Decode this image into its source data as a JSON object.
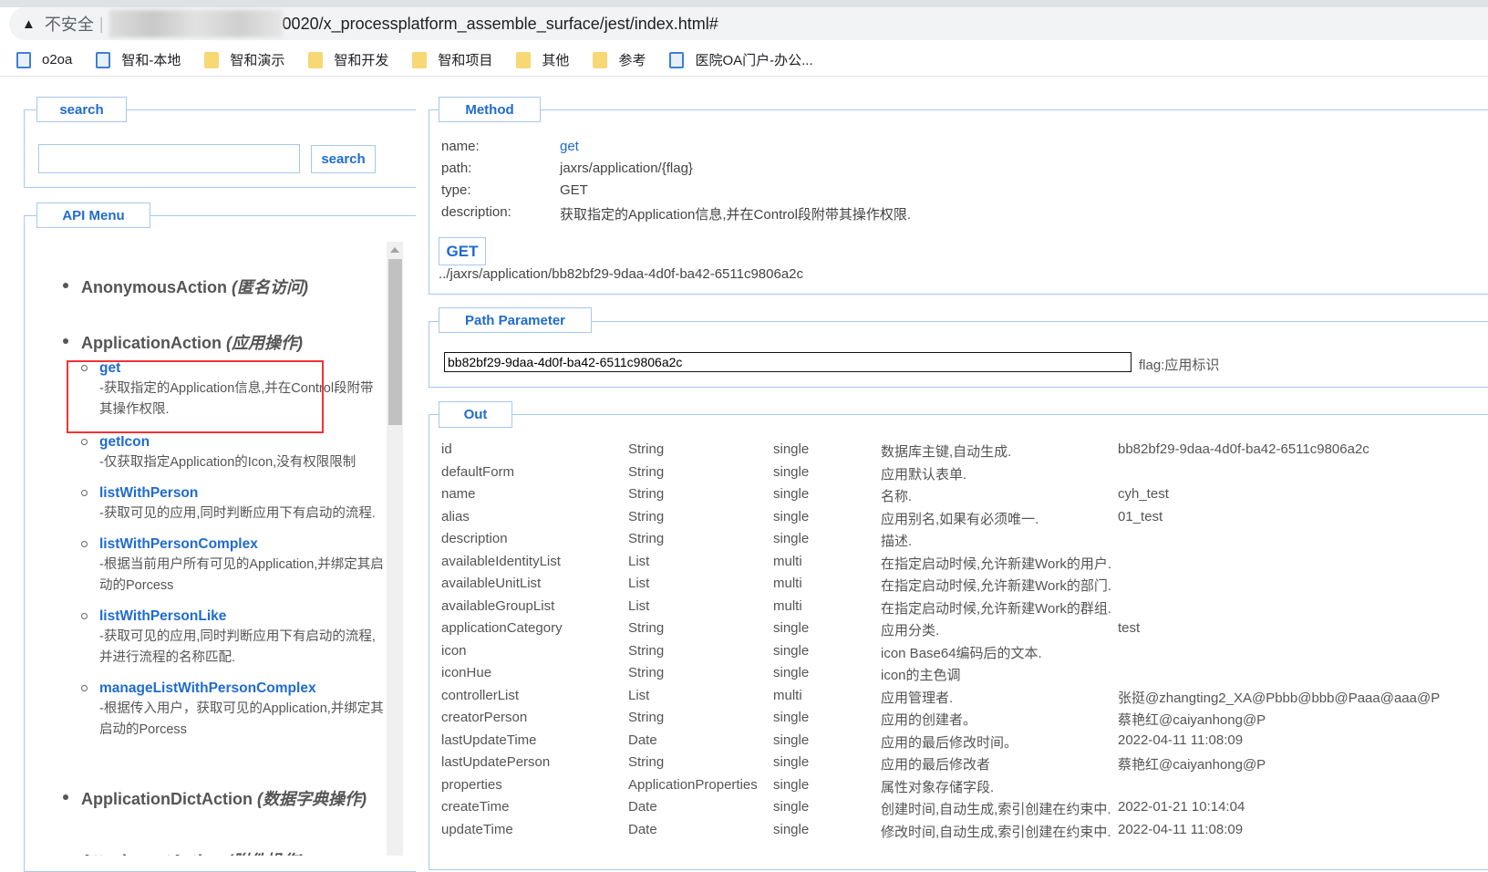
{
  "browser": {
    "insecure_label": "不安全",
    "url": "0020/x_processplatform_assemble_surface/jest/index.html#"
  },
  "bookmarks": [
    {
      "label": "o2oa",
      "icon": "page-icon"
    },
    {
      "label": "智和-本地",
      "icon": "page-icon"
    },
    {
      "label": "智和演示",
      "icon": "folder-icon"
    },
    {
      "label": "智和开发",
      "icon": "folder-icon"
    },
    {
      "label": "智和项目",
      "icon": "folder-icon"
    },
    {
      "label": "其他",
      "icon": "folder-icon"
    },
    {
      "label": "参考",
      "icon": "folder-icon"
    },
    {
      "label": "医院OA门户-办公...",
      "icon": "page-icon"
    }
  ],
  "search": {
    "legend": "search",
    "value": "",
    "button": "search"
  },
  "menu": {
    "legend": "API Menu",
    "groups": [
      {
        "name": "AnonymousAction",
        "cn": "(匿名访问)"
      },
      {
        "name": "ApplicationAction",
        "cn": "(应用操作)",
        "items": [
          {
            "name": "get",
            "desc": "-获取指定的Application信息,并在Control段附带其操作权限."
          },
          {
            "name": "getIcon",
            "desc": "-仅获取指定Application的Icon,没有权限限制"
          },
          {
            "name": "listWithPerson",
            "desc": "-获取可见的应用,同时判断应用下有启动的流程."
          },
          {
            "name": "listWithPersonComplex",
            "desc": "-根据当前用户所有可见的Application,并绑定其启动的Porcess"
          },
          {
            "name": "listWithPersonLike",
            "desc": "-获取可见的应用,同时判断应用下有启动的流程,并进行流程的名称匹配."
          },
          {
            "name": "manageListWithPersonComplex",
            "desc": "-根据传入用户，获取可见的Application,并绑定其启动的Porcess"
          }
        ]
      },
      {
        "name": "ApplicationDictAction",
        "cn": "(数据字典操作)"
      },
      {
        "name": "AttachmentAction",
        "cn": "(附件操作)"
      }
    ]
  },
  "method": {
    "legend": "Method",
    "name_label": "name:",
    "name": "get",
    "path_label": "path:",
    "path": "jaxrs/application/{flag}",
    "type_label": "type:",
    "type": "GET",
    "desc_label": "description:",
    "description": "获取指定的Application信息,并在Control段附带其操作权限.",
    "button": "GET",
    "url": "../jaxrs/application/bb82bf29-9daa-4d0f-ba42-6511c9806a2c"
  },
  "path_param": {
    "legend": "Path Parameter",
    "value": "bb82bf29-9daa-4d0f-ba42-6511c9806a2c",
    "label": "flag:应用标识"
  },
  "out": {
    "legend": "Out",
    "rows": [
      [
        "id",
        "String",
        "single",
        "数据库主键,自动生成.",
        "bb82bf29-9daa-4d0f-ba42-6511c9806a2c"
      ],
      [
        "defaultForm",
        "String",
        "single",
        "应用默认表单.",
        ""
      ],
      [
        "name",
        "String",
        "single",
        "名称.",
        "cyh_test"
      ],
      [
        "alias",
        "String",
        "single",
        "应用别名,如果有必须唯一.",
        "01_test"
      ],
      [
        "description",
        "String",
        "single",
        "描述.",
        ""
      ],
      [
        "availableIdentityList",
        "List",
        "multi",
        "在指定启动时候,允许新建Work的用户.",
        ""
      ],
      [
        "availableUnitList",
        "List",
        "multi",
        "在指定启动时候,允许新建Work的部门.",
        ""
      ],
      [
        "availableGroupList",
        "List",
        "multi",
        "在指定启动时候,允许新建Work的群组.",
        ""
      ],
      [
        "applicationCategory",
        "String",
        "single",
        "应用分类.",
        "test"
      ],
      [
        "icon",
        "String",
        "single",
        "icon Base64编码后的文本.",
        ""
      ],
      [
        "iconHue",
        "String",
        "single",
        "icon的主色调",
        ""
      ],
      [
        "controllerList",
        "List",
        "multi",
        "应用管理者.",
        "张挺@zhangting2_XA@Pbbb@bbb@Paaa@aaa@P"
      ],
      [
        "creatorPerson",
        "String",
        "single",
        "应用的创建者。",
        "蔡艳红@caiyanhong@P"
      ],
      [
        "lastUpdateTime",
        "Date",
        "single",
        "应用的最后修改时间。",
        "2022-04-11 11:08:09"
      ],
      [
        "lastUpdatePerson",
        "String",
        "single",
        "应用的最后修改者",
        "蔡艳红@caiyanhong@P"
      ],
      [
        "properties",
        "ApplicationProperties",
        "single",
        "属性对象存储字段.",
        ""
      ],
      [
        "createTime",
        "Date",
        "single",
        "创建时间,自动生成,索引创建在约束中.",
        "2022-01-21 10:14:04"
      ],
      [
        "updateTime",
        "Date",
        "single",
        "修改时间,自动生成,索引创建在约束中.",
        "2022-04-11 11:08:09"
      ]
    ]
  }
}
